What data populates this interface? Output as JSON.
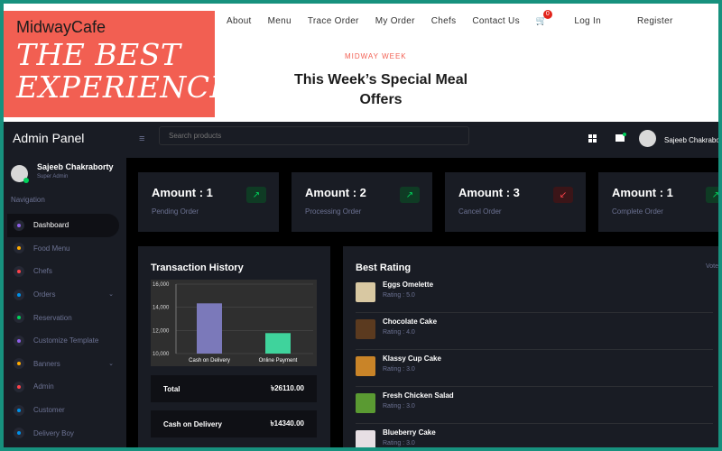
{
  "site": {
    "brand": "MidwayCafe",
    "tagline": "THE BEST EXPERIENCE",
    "nav": [
      "About",
      "Menu",
      "Trace Order",
      "My Order",
      "Chefs",
      "Contact Us"
    ],
    "cart_count": "0",
    "login": "Log In",
    "register": "Register",
    "section_label": "MIDWAY WEEK",
    "section_title": "This Week’s Special Meal Offers"
  },
  "admin": {
    "title": "Admin Panel",
    "search_placeholder": "Search products",
    "user": {
      "name": "Sajeeb Chakraborty",
      "role": "Super Admin",
      "top_name": "Sajeeb Chakrabo"
    },
    "navigation_label": "Navigation",
    "menu": [
      {
        "label": "Dashboard",
        "icon": "dashboard-icon",
        "color": "#8f5fe8",
        "active": true
      },
      {
        "label": "Food Menu",
        "icon": "food-menu-icon",
        "color": "#ffab00"
      },
      {
        "label": "Chefs",
        "icon": "chefs-icon",
        "color": "#fc424a"
      },
      {
        "label": "Orders",
        "icon": "orders-icon",
        "color": "#0090e7",
        "chevron": true
      },
      {
        "label": "Reservation",
        "icon": "reservation-icon",
        "color": "#00d25b"
      },
      {
        "label": "Customize Template",
        "icon": "template-icon",
        "color": "#8f5fe8"
      },
      {
        "label": "Banners",
        "icon": "banner-icon",
        "color": "#ffab00",
        "chevron": true
      },
      {
        "label": "Admin",
        "icon": "admin-icon",
        "color": "#fc424a"
      },
      {
        "label": "Customer",
        "icon": "customer-icon",
        "color": "#0090e7"
      },
      {
        "label": "Delivery Boy",
        "icon": "delivery-icon",
        "color": "#0090e7"
      }
    ],
    "stats": [
      {
        "amount": "Amount : 1",
        "label": "Pending Order",
        "icon": "arrow-up-right-icon",
        "color": "#00d25b"
      },
      {
        "amount": "Amount : 2",
        "label": "Processing Order",
        "icon": "arrow-up-right-icon",
        "color": "#00d25b"
      },
      {
        "amount": "Amount : 3",
        "label": "Cancel Order",
        "icon": "arrow-down-left-icon",
        "color": "#fc424a"
      },
      {
        "amount": "Amount : 1",
        "label": "Complete Order",
        "icon": "arrow-up-right-icon",
        "color": "#00d25b"
      }
    ],
    "transactions": {
      "title": "Transaction History",
      "total_label": "Total",
      "total_value": "৳26110.00",
      "cod_label": "Cash on Delivery",
      "cod_value": "৳14340.00"
    },
    "best_rating": {
      "title": "Best Rating",
      "side_label": "Vote",
      "items": [
        {
          "name": "Eggs Omelette",
          "rating": "Rating : 5.0",
          "thumb": "#d8c8a2"
        },
        {
          "name": "Chocolate Cake",
          "rating": "Rating : 4.0",
          "thumb": "#5b3a1f"
        },
        {
          "name": "Klassy Cup Cake",
          "rating": "Rating : 3.0",
          "thumb": "#c98428"
        },
        {
          "name": "Fresh Chicken Salad",
          "rating": "Rating : 3.0",
          "thumb": "#5a9a32"
        },
        {
          "name": "Blueberry Cake",
          "rating": "Rating : 3.0",
          "thumb": "#e7dfe4"
        }
      ]
    }
  },
  "chart_data": {
    "type": "bar",
    "categories": [
      "Cash on Delivery",
      "Online Payment"
    ],
    "values": [
      14340,
      11770
    ],
    "ylim": [
      10000,
      16000
    ],
    "yticks": [
      "16,000",
      "14,000",
      "12,000",
      "10,000"
    ],
    "colors": [
      "#7b79ba",
      "#3fd39c"
    ]
  }
}
